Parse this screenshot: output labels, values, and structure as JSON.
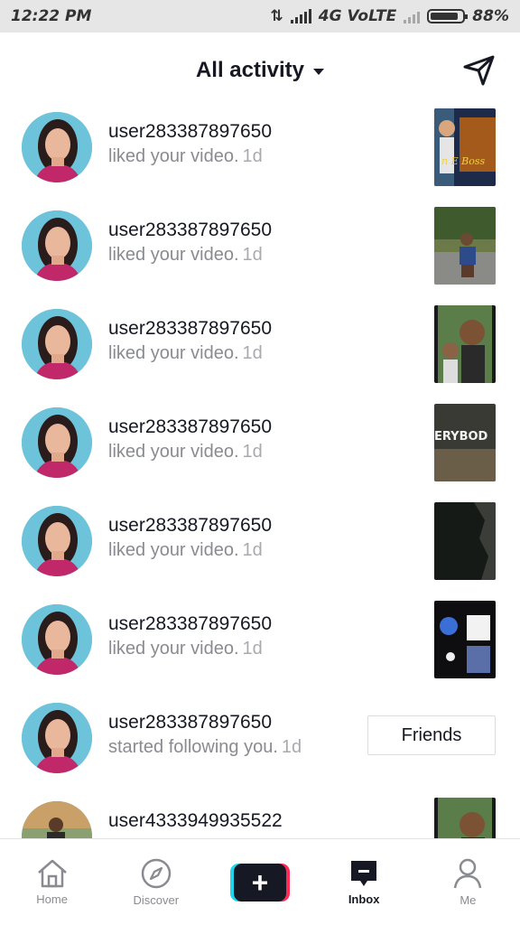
{
  "status_bar": {
    "time": "12:22 PM",
    "network": "4G VoLTE",
    "battery": "88%"
  },
  "header": {
    "title": "All activity"
  },
  "notifications": [
    {
      "username": "user283387897650",
      "action": "liked your video.",
      "time": "1d",
      "thumb": "thumb-1"
    },
    {
      "username": "user283387897650",
      "action": "liked your video.",
      "time": "1d",
      "thumb": "thumb-2"
    },
    {
      "username": "user283387897650",
      "action": "liked your video.",
      "time": "1d",
      "thumb": "thumb-3"
    },
    {
      "username": "user283387897650",
      "action": "liked your video.",
      "time": "1d",
      "thumb": "thumb-4"
    },
    {
      "username": "user283387897650",
      "action": "liked your video.",
      "time": "1d",
      "thumb": "thumb-5"
    },
    {
      "username": "user283387897650",
      "action": "liked your video.",
      "time": "1d",
      "thumb": "thumb-6"
    },
    {
      "username": "user283387897650",
      "action": "started following you.",
      "time": "1d",
      "button": "Friends"
    },
    {
      "username": "user4333949935522",
      "action": "",
      "time": "",
      "thumb": "thumb-8"
    }
  ],
  "thumb_texts": {
    "t1": "n E Boss",
    "t4": "ERYBOD"
  },
  "bottom_nav": {
    "home": "Home",
    "discover": "Discover",
    "inbox": "Inbox",
    "me": "Me"
  },
  "colors": {
    "accent_cyan": "#20d5ec",
    "accent_red": "#fe2c55",
    "text": "#161823",
    "muted": "#8a8b91"
  }
}
